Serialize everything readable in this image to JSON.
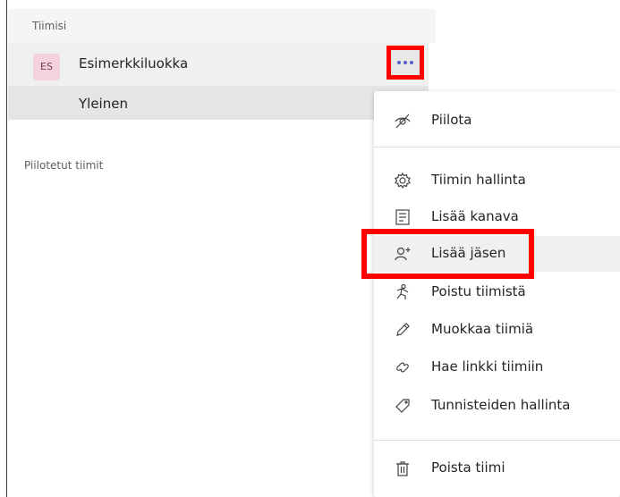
{
  "sidebar": {
    "teams_label": "Tiimisi",
    "hidden_label": "Piilotetut tiimit",
    "team": {
      "initials": "ES",
      "name": "Esimerkkiluokka"
    },
    "channel": {
      "name": "Yleinen"
    }
  },
  "menu": {
    "items": [
      {
        "label": "Piilota",
        "icon": "hide-icon"
      },
      {
        "label": "Tiimin hallinta",
        "icon": "gear-icon"
      },
      {
        "label": "Lisää kanava",
        "icon": "channel-icon"
      },
      {
        "label": "Lisää jäsen",
        "icon": "add-member-icon"
      },
      {
        "label": "Poistu tiimistä",
        "icon": "leave-icon"
      },
      {
        "label": "Muokkaa tiimiä",
        "icon": "pencil-icon"
      },
      {
        "label": "Hae linkki tiimiin",
        "icon": "link-icon"
      },
      {
        "label": "Tunnisteiden hallinta",
        "icon": "tag-icon"
      },
      {
        "label": "Poista tiimi",
        "icon": "trash-icon"
      }
    ]
  },
  "colors": {
    "accent": "#5b5fc7",
    "highlight_border": "#ff0000"
  }
}
